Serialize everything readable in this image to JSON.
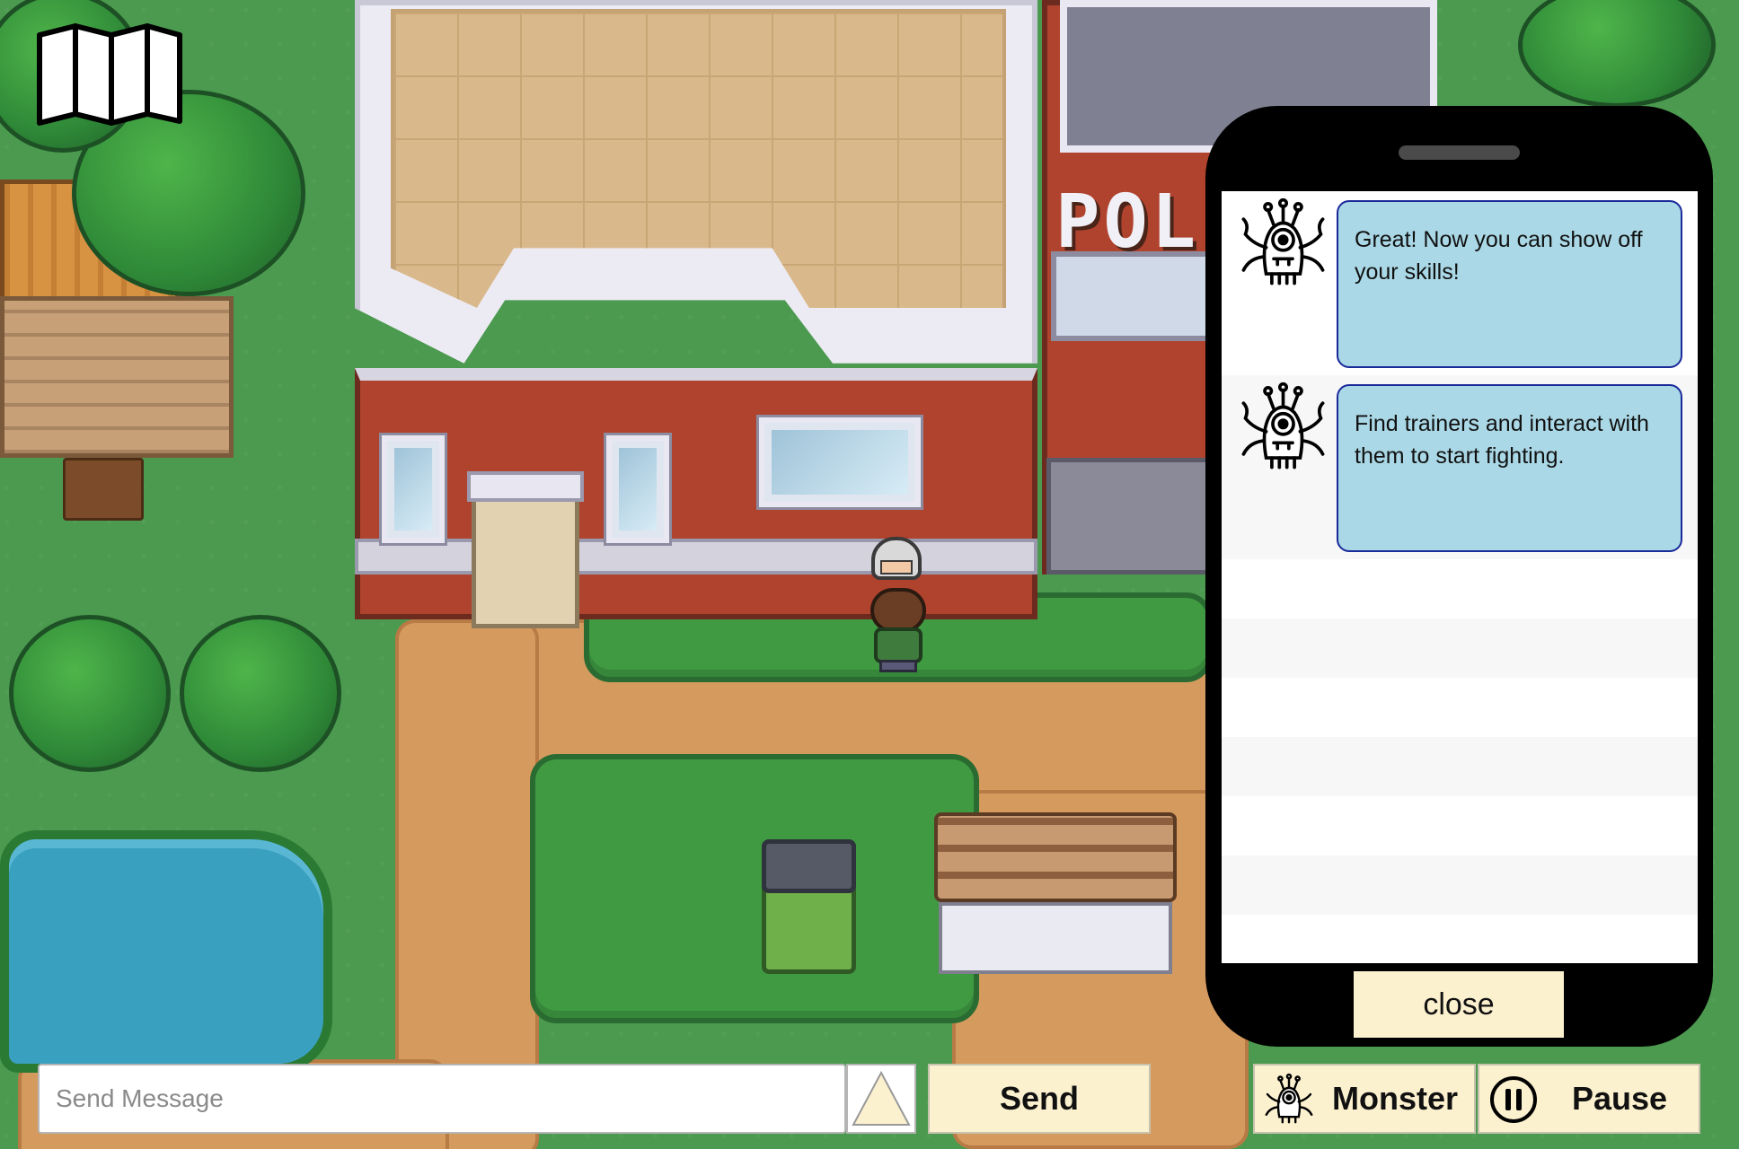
{
  "hud": {
    "map_icon": "folded-map-icon"
  },
  "phone": {
    "messages": [
      {
        "avatar_icon": "one-eyed-monster-icon",
        "text": "Great! Now you can show off your skills!"
      },
      {
        "avatar_icon": "one-eyed-monster-icon",
        "text": "Find trainers and interact with them to start fighting."
      }
    ],
    "close_label": "close"
  },
  "chat": {
    "placeholder": "Send Message",
    "value": "",
    "emoji_icon": "triangle-up-icon",
    "send_label": "Send"
  },
  "buttons": {
    "monster_label": "Monster",
    "monster_icon": "one-eyed-monster-icon",
    "pause_label": "Pause",
    "pause_icon": "pause-circle-icon"
  },
  "scene": {
    "police_sign": "POL"
  },
  "colors": {
    "cream_button": "#fcf1cf",
    "bubble": "#aad8e6",
    "bubble_border": "#1a2a9a",
    "grass": "#4b9a4f",
    "dirt": "#d49a5e"
  }
}
